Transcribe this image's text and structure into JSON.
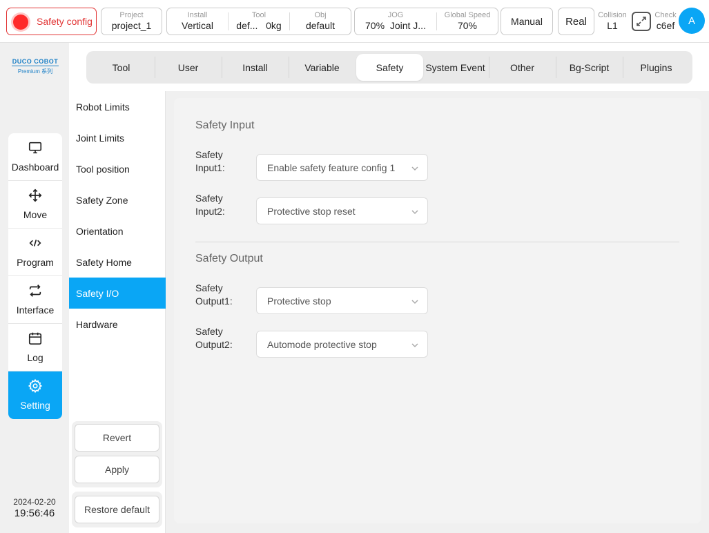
{
  "topbar": {
    "safety_label": "Safety config",
    "project": {
      "label": "Project",
      "value": "project_1"
    },
    "install": {
      "label": "Install",
      "value": "Vertical"
    },
    "tool": {
      "label": "Tool",
      "value_name": "def...",
      "value_weight": "0kg"
    },
    "obj": {
      "label": "Obj",
      "value": "default"
    },
    "jog": {
      "label": "JOG",
      "value_speed": "70%",
      "value_mode": "Joint J..."
    },
    "global_speed": {
      "label": "Global Speed",
      "value": "70%"
    },
    "mode_button": "Manual",
    "real_button": "Real",
    "collision": {
      "label": "Collision",
      "value": "L1"
    },
    "check": {
      "label": "Check",
      "value": "c6ef"
    },
    "avatar_letter": "A"
  },
  "logo": {
    "main": "DUCO COBOT",
    "sub": "Premium 系列"
  },
  "sidebar": {
    "items": [
      {
        "label": "Dashboard",
        "icon": "monitor-icon"
      },
      {
        "label": "Move",
        "icon": "move-arrows-icon"
      },
      {
        "label": "Program",
        "icon": "code-icon"
      },
      {
        "label": "Interface",
        "icon": "swap-arrows-icon"
      },
      {
        "label": "Log",
        "icon": "calendar-icon"
      },
      {
        "label": "Setting",
        "icon": "gear-icon"
      }
    ],
    "active": "Setting",
    "date": "2024-02-20",
    "time": "19:56:46"
  },
  "tabs": {
    "items": [
      "Tool",
      "User",
      "Install",
      "Variable",
      "Safety",
      "System Event",
      "Other",
      "Bg-Script",
      "Plugins"
    ],
    "active": "Safety"
  },
  "submenu": {
    "items": [
      "Robot Limits",
      "Joint Limits",
      "Tool position",
      "Safety Zone",
      "Orientation",
      "Safety Home",
      "Safety I/O",
      "Hardware"
    ],
    "active": "Safety I/O",
    "revert": "Revert",
    "apply": "Apply",
    "restore": "Restore default"
  },
  "main": {
    "input_section": "Safety Input",
    "inputs": [
      {
        "label_l1": "Safety",
        "label_l2": "Input1:",
        "value": "Enable safety feature config 1"
      },
      {
        "label_l1": "Safety",
        "label_l2": "Input2:",
        "value": "Protective stop reset"
      }
    ],
    "output_section": "Safety Output",
    "outputs": [
      {
        "label_l1": "Safety",
        "label_l2": "Output1:",
        "value": "Protective stop"
      },
      {
        "label_l1": "Safety",
        "label_l2": "Output2:",
        "value": "Automode protective stop"
      }
    ]
  },
  "colors": {
    "accent": "#0aa6f5",
    "alarm": "#e23434"
  }
}
